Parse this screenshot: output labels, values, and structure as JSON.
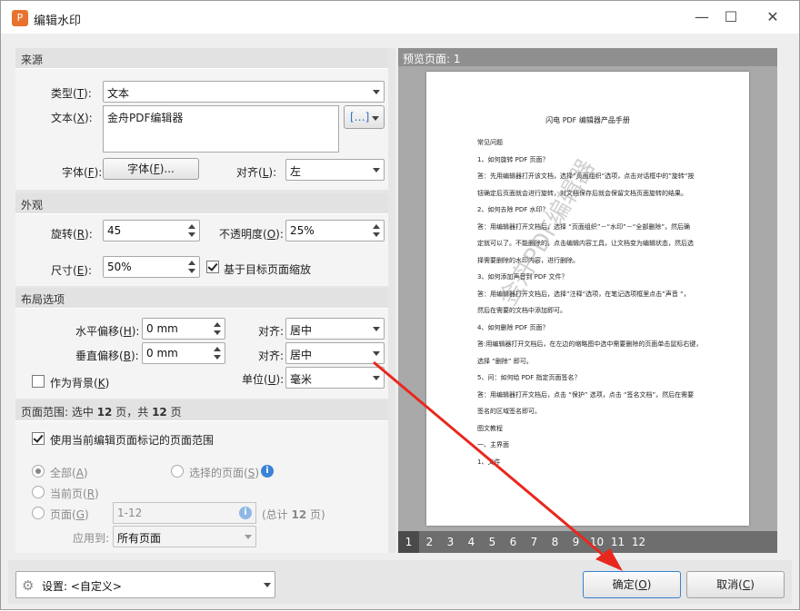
{
  "window": {
    "title": "编辑水印",
    "app_icon": "pdf-editor-icon",
    "controls": {
      "minimize": "—",
      "maximize": "☐",
      "close": "✕"
    }
  },
  "source": {
    "header": "来源",
    "type_label": "类型",
    "type_key": "T",
    "type_value": "文本",
    "text_label": "文本",
    "text_key": "X",
    "text_value": "金舟PDF编辑器",
    "insert_icon": "[…]",
    "font_label": "字体",
    "font_key": "F",
    "font_button": "字体",
    "font_button_key": "F",
    "font_button_suffix": "...",
    "align_label": "对齐",
    "align_key": "L",
    "align_value": "左"
  },
  "appearance": {
    "header": "外观",
    "rotation_label": "旋转",
    "rotation_key": "R",
    "rotation_value": "45",
    "opacity_label": "不透明度",
    "opacity_key": "O",
    "opacity_value": "25%",
    "size_label": "尺寸",
    "size_key": "E",
    "size_value": "50%",
    "scale_checkbox": "基于目标页面缩放",
    "scale_checked": true
  },
  "layout": {
    "header": "布局选项",
    "h_offset_label": "水平偏移",
    "h_offset_key": "H",
    "h_offset_value": "0 mm",
    "h_align_label": "对齐:",
    "h_align_value": "居中",
    "v_offset_label": "垂直偏移",
    "v_offset_key": "B",
    "v_offset_value": "0 mm",
    "v_align_label": "对齐:",
    "v_align_value": "居中",
    "background_label": "作为背景",
    "background_key": "K",
    "background_checked": false,
    "unit_label": "单位",
    "unit_key": "U",
    "unit_value": "毫米"
  },
  "page_range": {
    "header_prefix": "页面范围: 选中",
    "selected": "12",
    "header_mid": "页，共",
    "total": "12",
    "header_suffix": "页",
    "use_marked_label": "使用当前编辑页面标记的页面范围",
    "use_marked_checked": true,
    "all_label": "全部",
    "all_key": "A",
    "selected_pages_label": "选择的页面",
    "selected_pages_key": "S",
    "current_label": "当前页",
    "current_key": "R",
    "pages_label": "页面",
    "pages_key": "G",
    "pages_value": "1-12",
    "total_prefix": "(总计",
    "total_value": "12",
    "total_suffix": "页)",
    "apply_label": "应用到:",
    "apply_value": "所有页面"
  },
  "preview": {
    "title": "预览页面: 1",
    "doc_title": "闪电 PDF 编辑器产品手册",
    "doc_lines": [
      "常见问题",
      "1、如何旋转 PDF 页面？",
      "答：先用编辑器打开该文档，选择”页面组织“选项，点击对话框中的”旋转“按",
      "钮确定后页面就会进行旋转，对文档保存后就会保留文档页面旋转的结果。",
      "2、如何去除 PDF 水印？",
      "答：用编辑器打开文档后，选择 “页面组织”－“水印”－“全部删除”，然后确",
      "定就可以了。不能删除的，点击编辑内容工具，让文档变为编辑状态，然后选",
      "择需要删除的水印内容，进行删除。",
      "3、如何添加声音到 PDF 文件？",
      "答：用编辑器打开文档后，选择”注释“选项，在笔记选项框里点击”声音 “，",
      "然后在需要的文档中添加即可。",
      "4、如何删除 PDF 页面？",
      "答:用编辑器打开文档后，在左边的缩略图中选中需要删除的页面单击鼠标右键，",
      "选择 “删除” 即可。",
      "5、问：如何给 PDF 指定页面签名？",
      "答：用编辑器打开文档后，点击 “保护” 选项，点击 “签名文档”，然后在需要",
      "签名的区域签名即可。",
      "图文教程",
      "一、主界面",
      "1、文件"
    ],
    "watermark_text": "金舟PDF编辑器",
    "pages": [
      "1",
      "2",
      "3",
      "4",
      "5",
      "6",
      "7",
      "8",
      "9",
      "10",
      "11",
      "12"
    ],
    "selected_page": "1"
  },
  "footer": {
    "settings_icon": "gear-icon",
    "settings_label": "设置:",
    "settings_value": "<自定义>",
    "ok_label": "确定",
    "ok_key": "O",
    "cancel_label": "取消",
    "cancel_key": "C"
  },
  "annotation": {
    "arrow_color": "#e8281e"
  }
}
